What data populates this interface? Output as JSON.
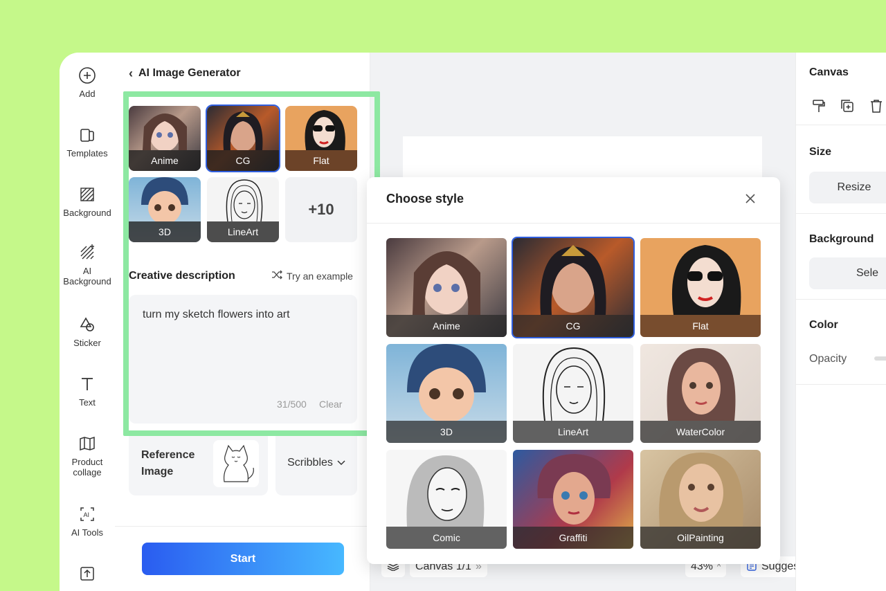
{
  "rail": {
    "items": [
      {
        "label": "Add",
        "icon": "plus-circle-icon"
      },
      {
        "label": "Templates",
        "icon": "templates-icon"
      },
      {
        "label": "Background",
        "icon": "background-icon"
      },
      {
        "label": "AI\nBackground",
        "icon": "ai-background-icon"
      },
      {
        "label": "Sticker",
        "icon": "sticker-icon"
      },
      {
        "label": "Text",
        "icon": "text-icon"
      },
      {
        "label": "Product\ncollage",
        "icon": "collage-icon"
      },
      {
        "label": "AI Tools",
        "icon": "ai-tools-icon"
      }
    ]
  },
  "panel": {
    "title": "AI Image Generator",
    "styles": [
      {
        "label": "Anime",
        "selected": false
      },
      {
        "label": "CG",
        "selected": true
      },
      {
        "label": "Flat",
        "selected": false
      },
      {
        "label": "3D",
        "selected": false
      },
      {
        "label": "LineArt",
        "selected": false
      }
    ],
    "more_label": "+10",
    "desc_title": "Creative description",
    "try_example": "Try an example",
    "desc_value": "turn my sketch flowers into art",
    "char_count": "31/500",
    "clear_label": "Clear",
    "reference_label": "Reference Image",
    "scribbles_label": "Scribbles",
    "start_label": "Start"
  },
  "bottombar": {
    "canvas_label": "Canvas 1/1",
    "zoom": "43%",
    "suggest": "Suggest",
    "help": "?"
  },
  "right": {
    "canvas_title": "Canvas",
    "size_title": "Size",
    "resize_label": "Resize",
    "background_title": "Background",
    "select_label": "Sele",
    "color_title": "Color",
    "opacity_label": "Opacity"
  },
  "dialog": {
    "title": "Choose style",
    "styles": [
      {
        "label": "Anime",
        "selected": false
      },
      {
        "label": "CG",
        "selected": true
      },
      {
        "label": "Flat",
        "selected": false
      },
      {
        "label": "3D",
        "selected": false
      },
      {
        "label": "LineArt",
        "selected": false
      },
      {
        "label": "WaterColor",
        "selected": false
      },
      {
        "label": "Comic",
        "selected": false
      },
      {
        "label": "Graffiti",
        "selected": false
      },
      {
        "label": "OilPainting",
        "selected": false
      }
    ]
  },
  "colors": {
    "page_bg": "#c5f88a",
    "highlight": "#8de8a2",
    "accent": "#2f5fe0"
  }
}
